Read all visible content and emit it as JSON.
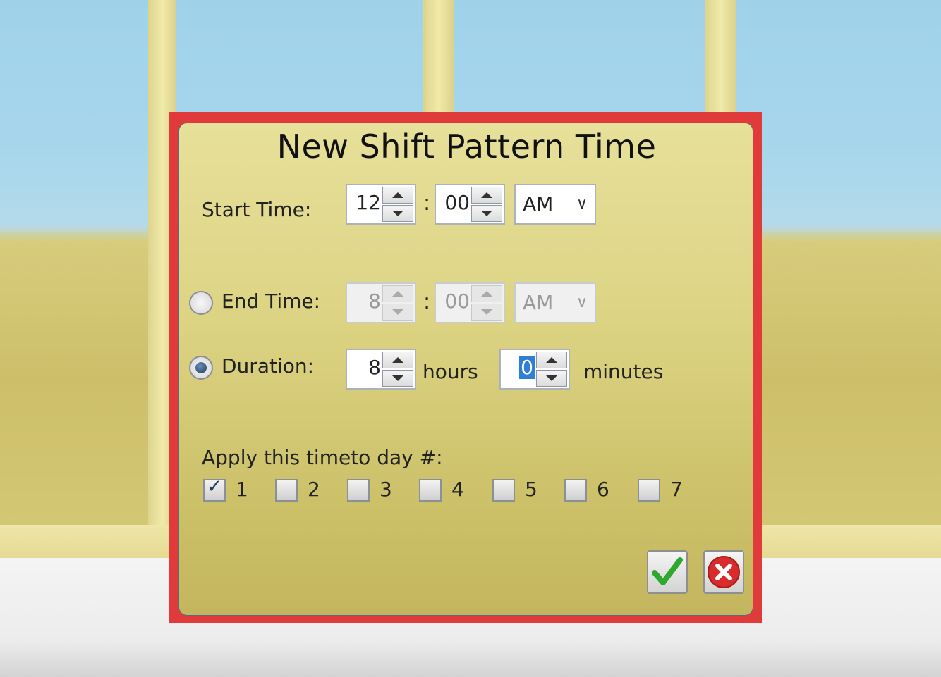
{
  "dialog": {
    "title": "New Shift Pattern Time",
    "start": {
      "label": "Start Time:",
      "hour": "12",
      "minute": "00",
      "ampm": "AM"
    },
    "end": {
      "label": "End Time:",
      "hour": "8",
      "minute": "00",
      "ampm": "AM"
    },
    "duration": {
      "label": "Duration:",
      "hours": "8",
      "hours_label": "hours",
      "minutes": "0",
      "minutes_label": "minutes"
    },
    "separator": ":",
    "days_label": "Apply this timeto day #:",
    "days": [
      {
        "label": "1",
        "checked": true
      },
      {
        "label": "2",
        "checked": false
      },
      {
        "label": "3",
        "checked": false
      },
      {
        "label": "4",
        "checked": false
      },
      {
        "label": "5",
        "checked": false
      },
      {
        "label": "6",
        "checked": false
      },
      {
        "label": "7",
        "checked": false
      }
    ],
    "selected_mode": "duration",
    "checkmark_glyph": "✓",
    "icons": {
      "ok": "green-check-icon",
      "cancel": "red-x-icon"
    },
    "colors": {
      "highlight_border": "#e03a3a",
      "ok": "#2ea82e",
      "cancel": "#d92b2b"
    }
  }
}
